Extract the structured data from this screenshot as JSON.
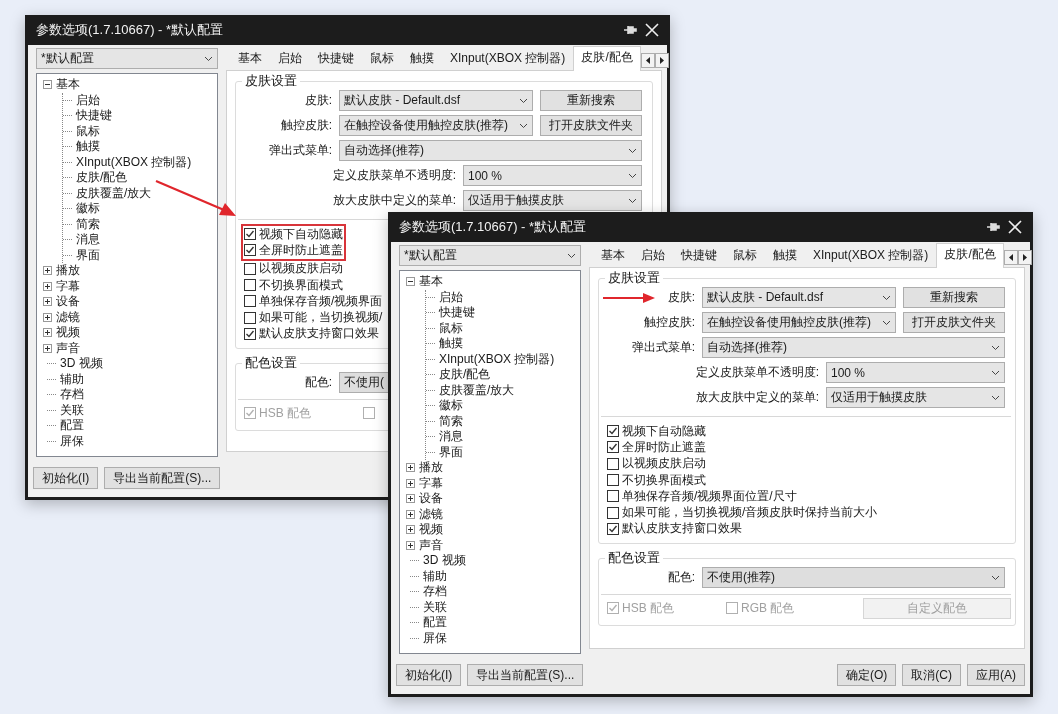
{
  "windows": [
    {
      "title": "参数选项(1.7.10667) - *默认配置",
      "profile": "*默认配置",
      "tree": [
        {
          "label": "基本",
          "expanded": true,
          "children": [
            {
              "label": "启始"
            },
            {
              "label": "快捷键"
            },
            {
              "label": "鼠标"
            },
            {
              "label": "触摸"
            },
            {
              "label": "XInput(XBOX 控制器)"
            },
            {
              "label": "皮肤/配色"
            },
            {
              "label": "皮肤覆盖/放大"
            },
            {
              "label": "徽标"
            },
            {
              "label": "简索"
            },
            {
              "label": "消息"
            },
            {
              "label": "界面"
            }
          ]
        },
        {
          "label": "播放",
          "expanded": false
        },
        {
          "label": "字幕",
          "expanded": false
        },
        {
          "label": "设备",
          "expanded": false
        },
        {
          "label": "滤镜",
          "expanded": false
        },
        {
          "label": "视频",
          "expanded": false
        },
        {
          "label": "声音",
          "expanded": false
        },
        {
          "label": "3D 视频"
        },
        {
          "label": "辅助"
        },
        {
          "label": "存档"
        },
        {
          "label": "关联"
        },
        {
          "label": "配置"
        },
        {
          "label": "屏保"
        }
      ],
      "tabs": [
        {
          "label": "基本",
          "selected": false
        },
        {
          "label": "启始",
          "selected": false
        },
        {
          "label": "快捷键",
          "selected": false
        },
        {
          "label": "鼠标",
          "selected": false
        },
        {
          "label": "触摸",
          "selected": false
        },
        {
          "label": "XInput(XBOX 控制器)",
          "selected": false
        },
        {
          "label": "皮肤/配色",
          "selected": true
        }
      ],
      "skin_group": {
        "title": "皮肤设置",
        "rows": [
          {
            "kind": "combo_button",
            "label": "皮肤:",
            "value": "默认皮肤 - Default.dsf",
            "button": "重新搜索",
            "marked": false
          },
          {
            "kind": "combo_button",
            "label": "触控皮肤:",
            "value": "在触控设备使用触控皮肤(推荐)",
            "button": "打开皮肤文件夹",
            "marked": false
          },
          {
            "kind": "combo",
            "label": "弹出式菜单:",
            "value": "自动选择(推荐)",
            "marked": false
          },
          {
            "kind": "sub_combo",
            "label": "定义皮肤菜单不透明度:",
            "value": "100 %",
            "marked": false
          },
          {
            "kind": "sub_combo",
            "label": "放大皮肤中定义的菜单:",
            "value": "仅适用于触摸皮肤",
            "marked": false
          }
        ],
        "checks": [
          {
            "label": "视频下自动隐藏",
            "checked": true,
            "highlighted": true
          },
          {
            "label": "全屏时防止遮盖",
            "checked": true,
            "highlighted": true
          },
          {
            "label": "以视频皮肤启动",
            "checked": false,
            "highlighted": false
          },
          {
            "label": "不切换界面模式",
            "checked": false,
            "highlighted": false
          },
          {
            "label": "单独保存音频/视频界面",
            "checked": false,
            "highlighted": false
          },
          {
            "label": "如果可能，当切换视频/",
            "checked": false,
            "highlighted": false
          },
          {
            "label": "默认皮肤支持窗口效果",
            "checked": true,
            "highlighted": false
          }
        ]
      },
      "color_group": {
        "title": "配色设置",
        "label": "配色:",
        "value": "不使用(",
        "options": [
          {
            "label": "HSB 配色",
            "checked": true,
            "disabled": true
          },
          {
            "checked": false,
            "disabled": true
          }
        ]
      },
      "buttons_left": [
        "初始化(I)",
        "导出当前配置(S)..."
      ]
    },
    {
      "title": "参数选项(1.7.10667) - *默认配置",
      "profile": "*默认配置",
      "tree": [
        {
          "label": "基本",
          "expanded": true,
          "children": [
            {
              "label": "启始"
            },
            {
              "label": "快捷键"
            },
            {
              "label": "鼠标"
            },
            {
              "label": "触摸"
            },
            {
              "label": "XInput(XBOX 控制器)"
            },
            {
              "label": "皮肤/配色"
            },
            {
              "label": "皮肤覆盖/放大"
            },
            {
              "label": "徽标"
            },
            {
              "label": "简索"
            },
            {
              "label": "消息"
            },
            {
              "label": "界面"
            }
          ]
        },
        {
          "label": "播放",
          "expanded": false
        },
        {
          "label": "字幕",
          "expanded": false
        },
        {
          "label": "设备",
          "expanded": false
        },
        {
          "label": "滤镜",
          "expanded": false
        },
        {
          "label": "视频",
          "expanded": false
        },
        {
          "label": "声音",
          "expanded": false
        },
        {
          "label": "3D 视频"
        },
        {
          "label": "辅助"
        },
        {
          "label": "存档"
        },
        {
          "label": "关联"
        },
        {
          "label": "配置"
        },
        {
          "label": "屏保"
        }
      ],
      "tabs": [
        {
          "label": "基本",
          "selected": false
        },
        {
          "label": "启始",
          "selected": false
        },
        {
          "label": "快捷键",
          "selected": false
        },
        {
          "label": "鼠标",
          "selected": false
        },
        {
          "label": "触摸",
          "selected": false
        },
        {
          "label": "XInput(XBOX 控制器)",
          "selected": false
        },
        {
          "label": "皮肤/配色",
          "selected": true
        }
      ],
      "skin_group": {
        "title": "皮肤设置",
        "rows": [
          {
            "kind": "combo_button",
            "label": "皮肤:",
            "value": "默认皮肤 - Default.dsf",
            "button": "重新搜索",
            "marked": true
          },
          {
            "kind": "combo_button",
            "label": "触控皮肤:",
            "value": "在触控设备使用触控皮肤(推荐)",
            "button": "打开皮肤文件夹",
            "marked": false
          },
          {
            "kind": "combo",
            "label": "弹出式菜单:",
            "value": "自动选择(推荐)",
            "marked": false
          },
          {
            "kind": "sub_combo",
            "label": "定义皮肤菜单不透明度:",
            "value": "100 %",
            "marked": false
          },
          {
            "kind": "sub_combo",
            "label": "放大皮肤中定义的菜单:",
            "value": "仅适用于触摸皮肤",
            "marked": false
          }
        ],
        "checks": [
          {
            "label": "视频下自动隐藏",
            "checked": true,
            "highlighted": false
          },
          {
            "label": "全屏时防止遮盖",
            "checked": true,
            "highlighted": false
          },
          {
            "label": "以视频皮肤启动",
            "checked": false,
            "highlighted": false
          },
          {
            "label": "不切换界面模式",
            "checked": false,
            "highlighted": false
          },
          {
            "label": "单独保存音频/视频界面位置/尺寸",
            "checked": false,
            "highlighted": false
          },
          {
            "label": "如果可能，当切换视频/音频皮肤时保持当前大小",
            "checked": false,
            "highlighted": false
          },
          {
            "label": "默认皮肤支持窗口效果",
            "checked": true,
            "highlighted": false
          }
        ]
      },
      "color_group": {
        "title": "配色设置",
        "label": "配色:",
        "value": "不使用(推荐)",
        "options": [
          {
            "label": "HSB 配色",
            "checked": true,
            "disabled": true
          },
          {
            "label": "RGB 配色",
            "checked": false,
            "disabled": true
          }
        ],
        "button": {
          "label": "自定义配色",
          "disabled": true
        }
      },
      "buttons_left": [
        "初始化(I)",
        "导出当前配置(S)..."
      ],
      "buttons_right": [
        "确定(O)",
        "取消(C)",
        "应用(A)"
      ]
    }
  ]
}
